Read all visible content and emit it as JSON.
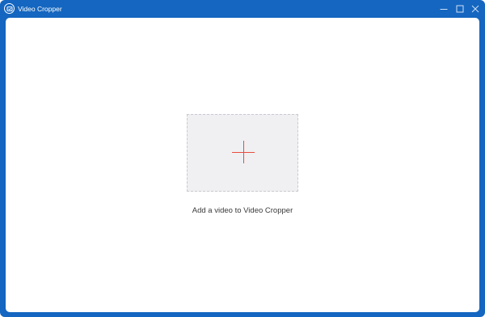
{
  "window": {
    "title": "Video Cropper",
    "accent_color": "#1466c0",
    "icon": "app-logo-icon",
    "controls": {
      "minimize_icon": "minimize-icon",
      "maximize_icon": "maximize-icon",
      "close_icon": "close-icon"
    }
  },
  "main": {
    "dropzone": {
      "icon": "add-plus-icon",
      "icon_color": "#e84b3c",
      "background_color": "#f0f0f3"
    },
    "add_label": "Add a video to Video Cropper"
  }
}
